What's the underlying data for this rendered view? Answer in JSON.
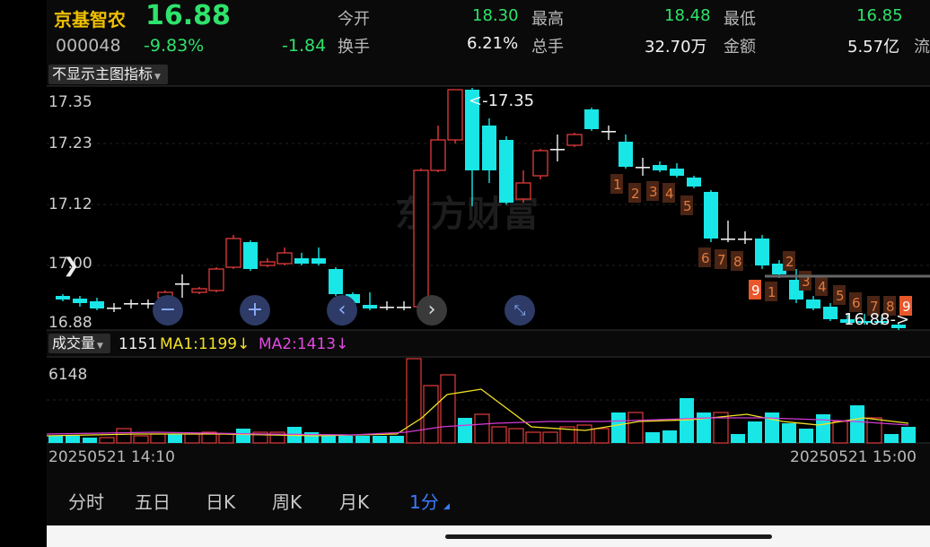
{
  "stock": {
    "name": "京基智农",
    "price": "16.88",
    "code": "000048",
    "change_pct": "-9.83%",
    "change": "-1.84"
  },
  "stats": {
    "open_label": "今开",
    "open_value": "18.30",
    "high_label": "最高",
    "high_value": "18.48",
    "low_label": "最低",
    "low_value": "16.85",
    "turnover_label": "换手",
    "turnover_value": "6.21%",
    "volume_label": "总手",
    "volume_value": "32.70万",
    "amount_label": "金额",
    "amount_value": "5.57亿",
    "flow_label": "流"
  },
  "main_chart": {
    "toggle_label": "不显示主图指标",
    "y_labels": [
      "17.35",
      "17.23",
      "17.12",
      "17.00",
      "16.88"
    ],
    "max_marker": "<-17.35",
    "last_marker": "16.88->",
    "watermark": "东方财富",
    "seq_markers": [
      "1",
      "2",
      "3",
      "4",
      "5",
      "6",
      "7",
      "8",
      "9",
      "1",
      "2",
      "3",
      "4",
      "5",
      "6",
      "7",
      "8",
      "9"
    ]
  },
  "volume_chart": {
    "label": "成交量",
    "current": "1151",
    "ma1": "MA1:1199",
    "ma2": "MA2:1413",
    "max_value": "6148",
    "arrow_down": "↓"
  },
  "time_axis": {
    "start": "20250521 14:10",
    "end": "20250521 15:00"
  },
  "periods": [
    "分时",
    "五日",
    "日K",
    "周K",
    "月K",
    "1分"
  ],
  "active_period": "1分",
  "colors": {
    "up": "#e23b3b",
    "down": "#19e6e6",
    "ma1": "#f2e224",
    "ma2": "#d43ad4",
    "seq_marker": "#c65a1e",
    "accent": "#3a7bff"
  }
}
